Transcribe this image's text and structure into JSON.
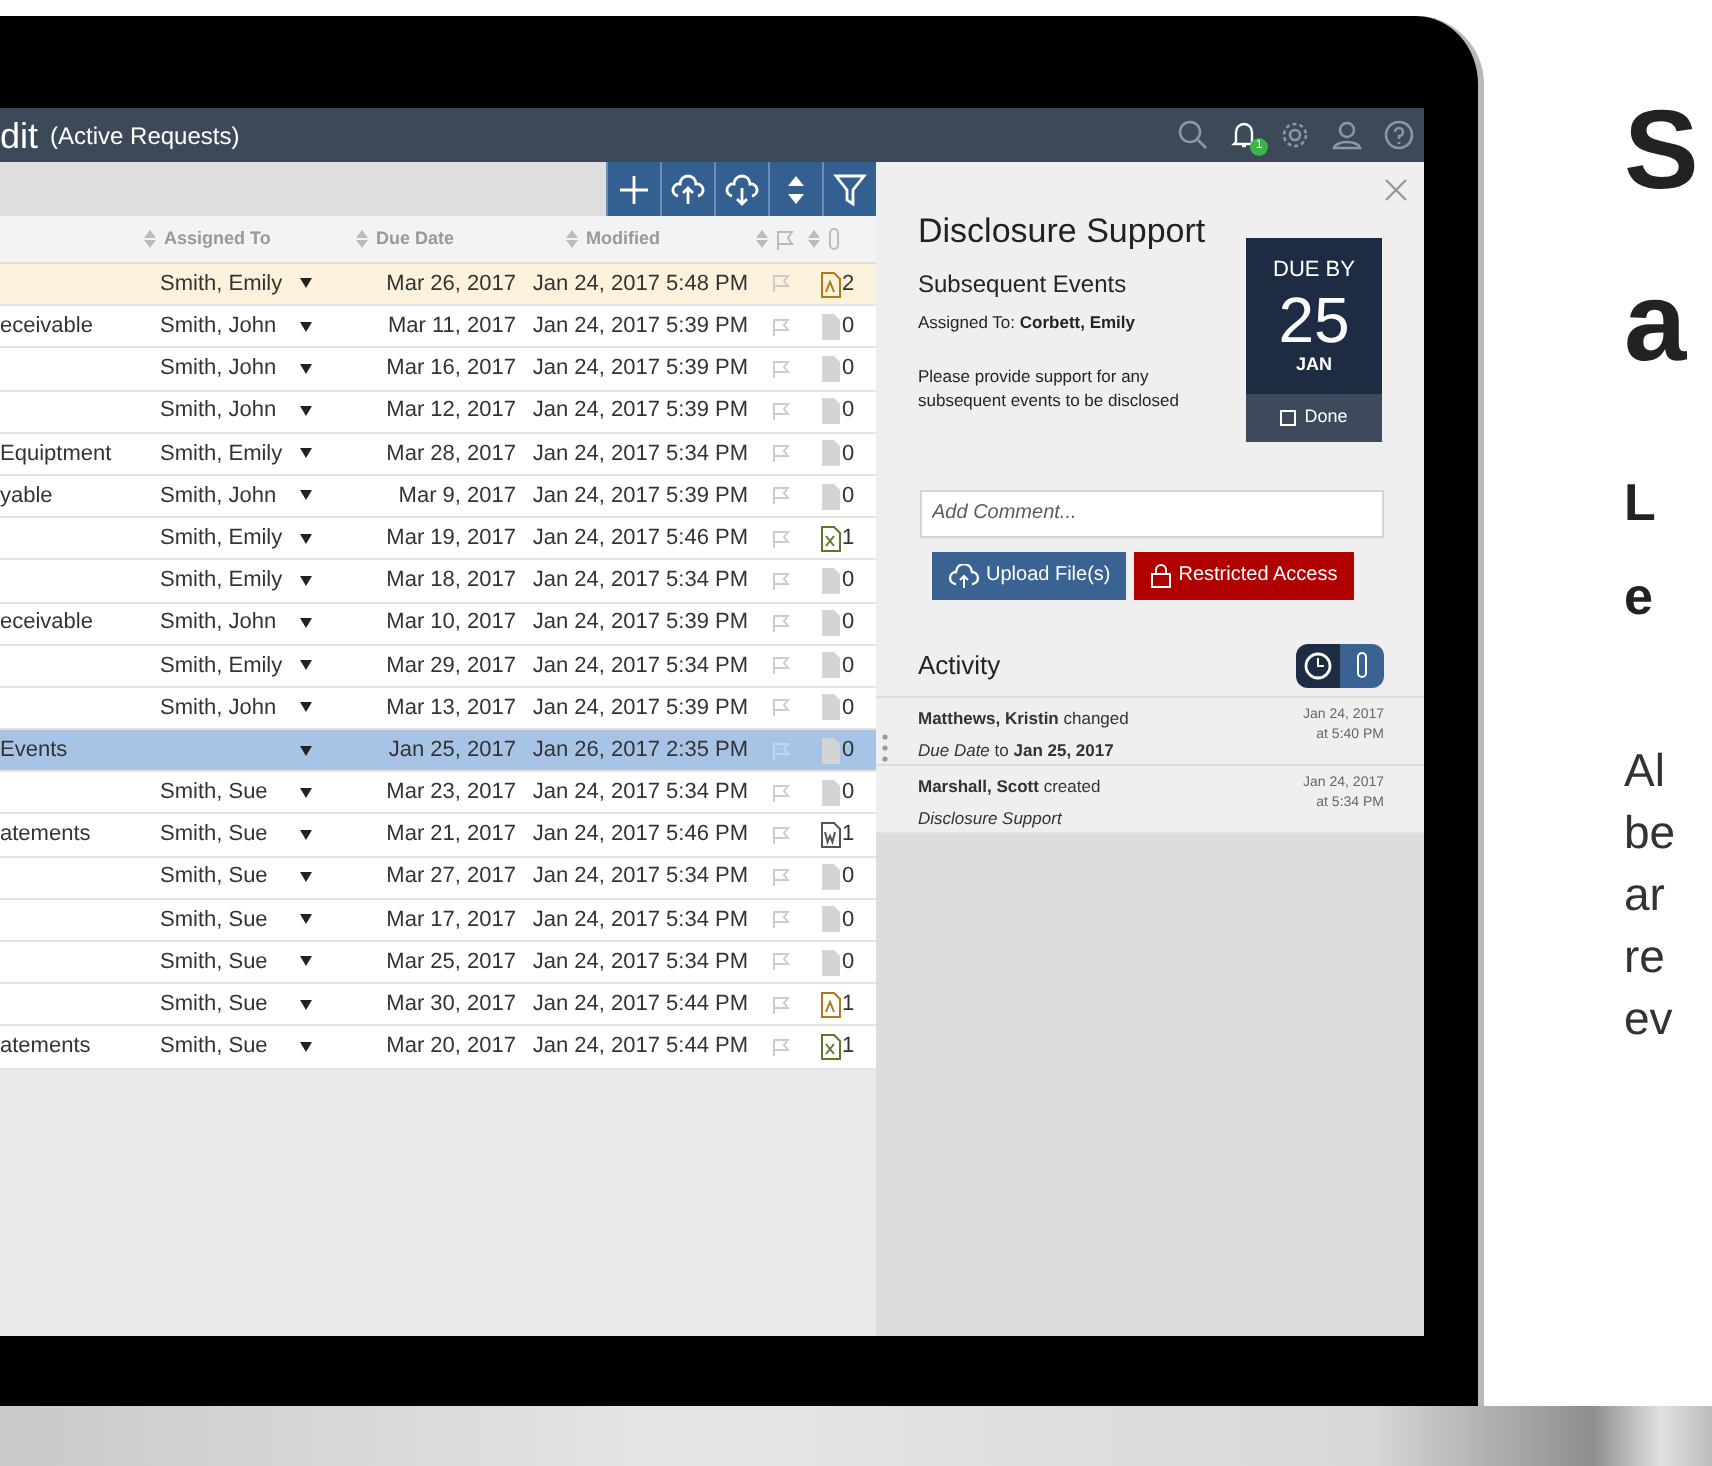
{
  "header": {
    "title": "dit",
    "subtitle": "(Active Requests)",
    "notification_count": "1"
  },
  "toolbar_buttons": [
    {
      "kind": "add"
    },
    {
      "kind": "upload"
    },
    {
      "kind": "download"
    },
    {
      "kind": "sort"
    },
    {
      "kind": "filter"
    }
  ],
  "table": {
    "columns": [
      "Assigned To",
      "Due Date",
      "Modified"
    ],
    "rows": [
      {
        "name": "",
        "assigned": "Smith, Emily",
        "due": "Mar 26, 2017",
        "modified": "Jan 24, 2017 5:48 PM",
        "kind": "pdf",
        "files": "2",
        "highlighted": true,
        "selected": false
      },
      {
        "name": "eceivable",
        "assigned": "Smith, John",
        "due": "Mar 11, 2017",
        "modified": "Jan 24, 2017 5:39 PM",
        "kind": "none",
        "files": "0",
        "highlighted": false,
        "selected": false
      },
      {
        "name": "",
        "assigned": "Smith, John",
        "due": "Mar 16, 2017",
        "modified": "Jan 24, 2017 5:39 PM",
        "kind": "none",
        "files": "0",
        "highlighted": false,
        "selected": false
      },
      {
        "name": "",
        "assigned": "Smith, John",
        "due": "Mar 12, 2017",
        "modified": "Jan 24, 2017 5:39 PM",
        "kind": "none",
        "files": "0",
        "highlighted": false,
        "selected": false
      },
      {
        "name": "Equiptment",
        "assigned": "Smith, Emily",
        "due": "Mar 28, 2017",
        "modified": "Jan 24, 2017 5:34 PM",
        "kind": "none",
        "files": "0",
        "highlighted": false,
        "selected": false
      },
      {
        "name": "yable",
        "assigned": "Smith, John",
        "due": "Mar 9, 2017",
        "modified": "Jan 24, 2017 5:39 PM",
        "kind": "none",
        "files": "0",
        "highlighted": false,
        "selected": false
      },
      {
        "name": "",
        "assigned": "Smith, Emily",
        "due": "Mar 19, 2017",
        "modified": "Jan 24, 2017 5:46 PM",
        "kind": "excel",
        "files": "1",
        "highlighted": false,
        "selected": false
      },
      {
        "name": "",
        "assigned": "Smith, Emily",
        "due": "Mar 18, 2017",
        "modified": "Jan 24, 2017 5:34 PM",
        "kind": "none",
        "files": "0",
        "highlighted": false,
        "selected": false
      },
      {
        "name": "eceivable",
        "assigned": "Smith, John",
        "due": "Mar 10, 2017",
        "modified": "Jan 24, 2017 5:39 PM",
        "kind": "none",
        "files": "0",
        "highlighted": false,
        "selected": false
      },
      {
        "name": "",
        "assigned": "Smith, Emily",
        "due": "Mar 29, 2017",
        "modified": "Jan 24, 2017 5:34 PM",
        "kind": "none",
        "files": "0",
        "highlighted": false,
        "selected": false
      },
      {
        "name": "",
        "assigned": "Smith, John",
        "due": "Mar 13, 2017",
        "modified": "Jan 24, 2017 5:39 PM",
        "kind": "none",
        "files": "0",
        "highlighted": false,
        "selected": false
      },
      {
        "name": "Events",
        "assigned": "",
        "due": "Jan 25, 2017",
        "modified": "Jan 26, 2017 2:35 PM",
        "kind": "none",
        "files": "0",
        "highlighted": false,
        "selected": true
      },
      {
        "name": "",
        "assigned": "Smith, Sue",
        "due": "Mar 23, 2017",
        "modified": "Jan 24, 2017 5:34 PM",
        "kind": "none",
        "files": "0",
        "highlighted": false,
        "selected": false
      },
      {
        "name": "atements",
        "assigned": "Smith, Sue",
        "due": "Mar 21, 2017",
        "modified": "Jan 24, 2017 5:46 PM",
        "kind": "word",
        "files": "1",
        "highlighted": false,
        "selected": false
      },
      {
        "name": "",
        "assigned": "Smith, Sue",
        "due": "Mar 27, 2017",
        "modified": "Jan 24, 2017 5:34 PM",
        "kind": "none",
        "files": "0",
        "highlighted": false,
        "selected": false
      },
      {
        "name": "",
        "assigned": "Smith, Sue",
        "due": "Mar 17, 2017",
        "modified": "Jan 24, 2017 5:34 PM",
        "kind": "none",
        "files": "0",
        "highlighted": false,
        "selected": false
      },
      {
        "name": "",
        "assigned": "Smith, Sue",
        "due": "Mar 25, 2017",
        "modified": "Jan 24, 2017 5:34 PM",
        "kind": "none",
        "files": "0",
        "highlighted": false,
        "selected": false
      },
      {
        "name": "",
        "assigned": "Smith, Sue",
        "due": "Mar 30, 2017",
        "modified": "Jan 24, 2017 5:44 PM",
        "kind": "pdf",
        "files": "1",
        "highlighted": false,
        "selected": false
      },
      {
        "name": "atements",
        "assigned": "Smith, Sue",
        "due": "Mar 20, 2017",
        "modified": "Jan 24, 2017 5:44 PM",
        "kind": "excel",
        "files": "1",
        "highlighted": false,
        "selected": false
      }
    ]
  },
  "panel": {
    "title": "Disclosure Support",
    "subtitle": "Subsequent Events",
    "assigned": "Assigned To: **Corbett, Emily**",
    "description": "Please provide support for any subsequent events to be disclosed",
    "due": {
      "label": "DUE BY",
      "day": "25",
      "month": "JAN",
      "done_label": "Done",
      "done": false
    },
    "comment_placeholder": "Add Comment...",
    "buttons": [
      {
        "kind": "upload",
        "label": "Upload File(s)"
      },
      {
        "kind": "restricted",
        "label": "Restricted Access"
      }
    ]
  },
  "activity": {
    "title": "Activity",
    "view_toggle": [
      {
        "kind": "history",
        "selected": true
      },
      {
        "kind": "attachments",
        "selected": false
      }
    ],
    "entries": [
      {
        "summary": "**Matthews, Kristin** changed",
        "detail": "*Due Date* to **Jan 25, 2017**",
        "date": "Jan 24, 2017",
        "time": "at 5:40 PM"
      },
      {
        "summary": "**Marshall, Scott** created",
        "detail": "*Disclosure Support*",
        "date": "Jan 24, 2017",
        "time": "at 5:34 PM"
      }
    ]
  },
  "side_text": {
    "headline": [
      "S",
      "a"
    ],
    "subheading": [
      "L",
      "e"
    ],
    "body": [
      "Al",
      "be",
      "ar",
      "re",
      "ev"
    ]
  }
}
